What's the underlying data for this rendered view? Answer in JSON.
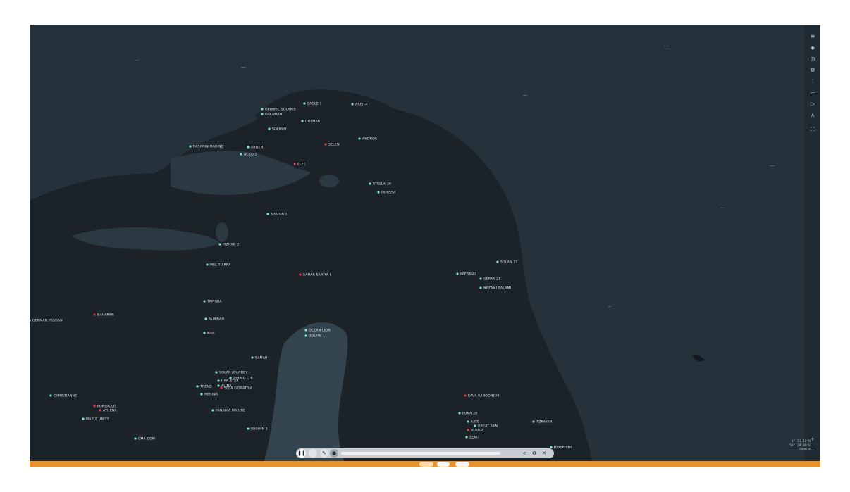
{
  "map": {
    "vessel_labels": [
      {
        "text": "EAGLE 1",
        "color": "#ffffff"
      },
      {
        "text": "ARISTA",
        "color": "#ffffff"
      },
      {
        "text": "OLYMPIC SOLARIS",
        "color": "#ffffff"
      },
      {
        "text": "DALAMAN",
        "color": "#ffffff"
      },
      {
        "text": "SOLMAR",
        "color": "#ffffff"
      },
      {
        "text": "DOLMAR",
        "color": "#ffffff"
      },
      {
        "text": "ANDROS",
        "color": "#ffffff"
      },
      {
        "text": "SELEN",
        "color": "#e23b4a"
      },
      {
        "text": "RASANIN MARINE",
        "color": "#ffffff"
      },
      {
        "text": "ARGENT",
        "color": "#ffffff"
      },
      {
        "text": "ACCO 1",
        "color": "#ffffff"
      },
      {
        "text": "ELFE",
        "color": "#e23b4a"
      },
      {
        "text": "STELLA 36",
        "color": "#ffffff"
      },
      {
        "text": "PARISSA",
        "color": "#ffffff"
      },
      {
        "text": "SHAHIN 1",
        "color": "#ffffff"
      },
      {
        "text": "PIZHAN 2",
        "color": "#ffffff"
      },
      {
        "text": "MEL TIARRA",
        "color": "#ffffff"
      },
      {
        "text": "SAHAR SARIYA I",
        "color": "#e23b4a"
      },
      {
        "text": "PAFRAND",
        "color": "#ffffff"
      },
      {
        "text": "SOLAN 21",
        "color": "#ffffff"
      },
      {
        "text": "GERAS 21",
        "color": "#ffffff"
      },
      {
        "text": "NEZAMI SALAMI",
        "color": "#ffffff"
      },
      {
        "text": "TAPHIRA",
        "color": "#ffffff"
      },
      {
        "text": "SAHARAN",
        "color": "#e23b4a"
      },
      {
        "text": "ALMIRAH",
        "color": "#ffffff"
      },
      {
        "text": "KIYA",
        "color": "#ffffff"
      },
      {
        "text": "OCEAN LION",
        "color": "#ffffff"
      },
      {
        "text": "DOLFIN 1",
        "color": "#ffffff"
      },
      {
        "text": "SAMAH",
        "color": "#ffffff"
      },
      {
        "text": "SOLAR JOURNEY",
        "color": "#ffffff"
      },
      {
        "text": "ZHENG CHI",
        "color": "#ffffff"
      },
      {
        "text": "HAN STAR",
        "color": "#ffffff"
      },
      {
        "text": "ALINA",
        "color": "#ffffff"
      },
      {
        "text": "SEJIA GOMATRIA",
        "color": "#e23b4a"
      },
      {
        "text": "TREND",
        "color": "#ffffff"
      },
      {
        "text": "MERINA",
        "color": "#ffffff"
      },
      {
        "text": "PANARIA MARINE",
        "color": "#ffffff"
      },
      {
        "text": "SHAHIN 3",
        "color": "#ffffff"
      },
      {
        "text": "CHRISTIANNE",
        "color": "#ffffff"
      },
      {
        "text": "PORSPOLIS",
        "color": "#e23b4a"
      },
      {
        "text": "ATHENA",
        "color": "#e23b4a"
      },
      {
        "text": "MAPLE UNITY",
        "color": "#ffffff"
      },
      {
        "text": "CMA CGM",
        "color": "#ffffff"
      },
      {
        "text": "KAVA SANGONGHI",
        "color": "#e23b4a"
      },
      {
        "text": "PUNA 2B",
        "color": "#ffffff"
      },
      {
        "text": "KATE",
        "color": "#ffffff"
      },
      {
        "text": "GREAT SAN",
        "color": "#ffffff"
      },
      {
        "text": "ALGIDA",
        "color": "#e23b4a"
      },
      {
        "text": "AZRAYAN",
        "color": "#ffffff"
      },
      {
        "text": "ZENIT",
        "color": "#ffffff"
      },
      {
        "text": "JOSEPHINE",
        "color": "#ffffff"
      },
      {
        "text": "GERMAN PASHAN",
        "color": "#ffffff"
      }
    ]
  },
  "toolbar": {
    "icons": [
      "menu-icon",
      "layers-icon",
      "location-icon",
      "settings-icon",
      "filter-icon",
      "measure-icon",
      "play-icon",
      "person-icon",
      "fullscreen-icon"
    ]
  },
  "playback": {
    "pause_glyph": "❚❚",
    "speed_label": "",
    "share_glyph": "<",
    "settings_glyph": "⚙",
    "close_glyph": "✕"
  },
  "coordinates": {
    "line1": "0° 21.10'N",
    "line2": "56° 28.00'E",
    "line3": "ZOOM 8"
  }
}
